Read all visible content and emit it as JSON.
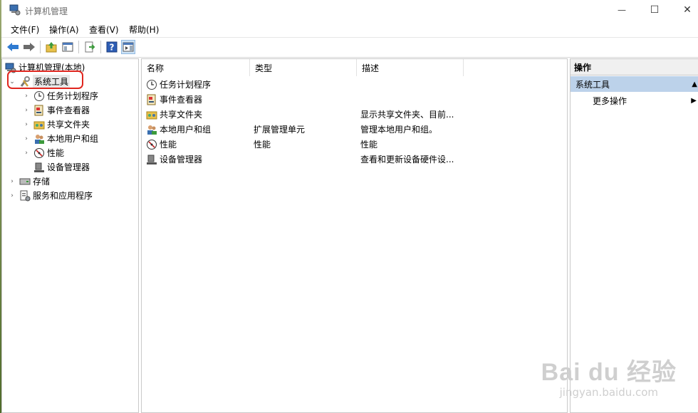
{
  "window": {
    "title": "计算机管理",
    "minimize_glyph": "—",
    "maximize_glyph": "☐",
    "close_glyph": "✕"
  },
  "menu": [
    {
      "label": "文件(F)"
    },
    {
      "label": "操作(A)"
    },
    {
      "label": "查看(V)"
    },
    {
      "label": "帮助(H)"
    }
  ],
  "toolbar": [
    "back-arrow-icon",
    "forward-arrow-icon",
    "up-folder-icon",
    "show-hide-tree-icon",
    "export-list-icon",
    "help-icon",
    "show-hide-action-pane-icon"
  ],
  "tree": {
    "root": {
      "label": "计算机管理(本地)"
    },
    "system_tools": {
      "label": "系统工具",
      "expanded": true
    },
    "children": [
      {
        "label": "任务计划程序",
        "icon": "clock-icon",
        "expandable": true
      },
      {
        "label": "事件查看器",
        "icon": "event-viewer-icon",
        "expandable": true
      },
      {
        "label": "共享文件夹",
        "icon": "shared-folder-icon",
        "expandable": true
      },
      {
        "label": "本地用户和组",
        "icon": "users-icon",
        "expandable": true
      },
      {
        "label": "性能",
        "icon": "performance-icon",
        "expandable": true
      },
      {
        "label": "设备管理器",
        "icon": "device-manager-icon",
        "expandable": false
      }
    ],
    "storage": {
      "label": "存储"
    },
    "services": {
      "label": "服务和应用程序"
    }
  },
  "list": {
    "columns": [
      "名称",
      "类型",
      "描述"
    ],
    "rows": [
      {
        "name": "任务计划程序",
        "type": "",
        "desc": ""
      },
      {
        "name": "事件查看器",
        "type": "",
        "desc": ""
      },
      {
        "name": "共享文件夹",
        "type": "",
        "desc": "显示共享文件夹、目前..."
      },
      {
        "name": "本地用户和组",
        "type": "扩展管理单元",
        "desc": "管理本地用户和组。"
      },
      {
        "name": "性能",
        "type": "性能",
        "desc": "性能"
      },
      {
        "name": "设备管理器",
        "type": "",
        "desc": "查看和更新设备硬件设..."
      }
    ]
  },
  "actions": {
    "header": "操作",
    "section": "系统工具",
    "more": "更多操作"
  },
  "watermark": {
    "brand": "Bai du 经验",
    "url": "jingyan.baidu.com"
  },
  "colors": {
    "selection_band": "#bcd2ea",
    "highlight_ring": "#e0261f"
  }
}
